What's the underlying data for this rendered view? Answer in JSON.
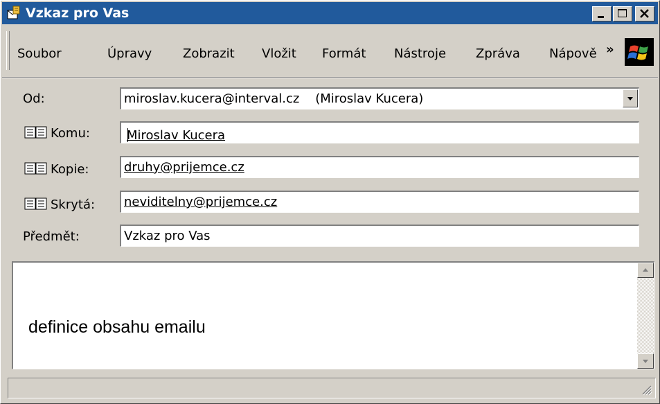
{
  "window": {
    "title": "Vzkaz pro Vas"
  },
  "menu": [
    "Soubor",
    "Úpravy",
    "Zobrazit",
    "Vložit",
    "Formát",
    "Nástroje",
    "Zpráva",
    "Nápově"
  ],
  "menu_more": "»",
  "header": {
    "from_label": "Od:",
    "from_value": "miroslav.kucera@interval.cz    (Miroslav Kucera)",
    "to_label": "Komu:",
    "to_value": "Miroslav Kucera",
    "cc_label": "Kopie:",
    "cc_value": "druhy@prijemce.cz",
    "bcc_label": "Skrytá:",
    "bcc_value": "neviditelny@prijemce.cz",
    "subject_label": "Předmět:",
    "subject_value": "Vzkaz pro Vas"
  },
  "body": {
    "text": "definice obsahu emailu"
  },
  "icons": {
    "title": "letter-icon",
    "address": "address-book-icon",
    "logo": "windows-logo-icon"
  },
  "colors": {
    "titlebar": "#215a9c",
    "chrome": "#d4d0c8"
  }
}
